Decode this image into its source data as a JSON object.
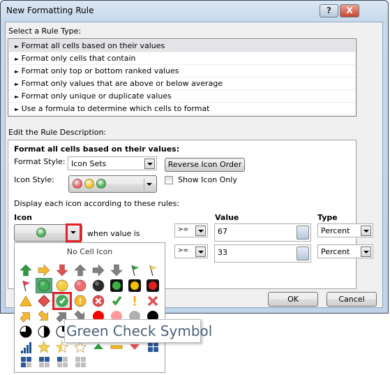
{
  "window": {
    "title": "New Formatting Rule",
    "help_label": "?",
    "close_label": "X"
  },
  "rule_type": {
    "label": "Select a Rule Type:",
    "items": [
      {
        "label": "Format all cells based on their values",
        "selected": true
      },
      {
        "label": "Format only cells that contain"
      },
      {
        "label": "Format only top or bottom ranked values"
      },
      {
        "label": "Format only values that are above or below average"
      },
      {
        "label": "Format only unique or duplicate values"
      },
      {
        "label": "Use a formula to determine which cells to format"
      }
    ],
    "bullet": "►"
  },
  "description": {
    "label": "Edit the Rule Description:",
    "heading": "Format all cells based on their values:",
    "format_style_label": "Format Style:",
    "format_style_value": "Icon Sets",
    "reverse_button": "Reverse Icon Order",
    "icon_style_label": "Icon Style:",
    "icon_style_colors": [
      "#e8636b",
      "#f5c52c",
      "#4caf5a"
    ],
    "show_icon_only_label": "Show Icon Only",
    "show_icon_only_checked": false,
    "rules_label": "Display each icon according to these rules:",
    "headers": {
      "icon": "Icon",
      "value": "Value",
      "type": "Type"
    },
    "rules": [
      {
        "icon_color": "#4caf5a",
        "when": "when value is",
        "operator": ">=",
        "value": "67",
        "type": "Percent"
      },
      {
        "operator": ">=",
        "value": "33",
        "type": "Percent"
      }
    ]
  },
  "buttons": {
    "ok": "OK",
    "cancel": "Cancel"
  },
  "icon_picker": {
    "no_icon_label": "No Cell Icon",
    "selected_icon": "green-circle",
    "hovered_icon": "green-check-symbol",
    "tooltip": "Green Check Symbol",
    "icons": [
      {
        "name": "green-up-arrow",
        "kind": "arrow",
        "rot": 0,
        "color": "#2e9b3e"
      },
      {
        "name": "yellow-right-arrow",
        "kind": "arrow",
        "rot": 90,
        "color": "#f5b82e"
      },
      {
        "name": "red-down-arrow",
        "kind": "arrow",
        "rot": 180,
        "color": "#e45050"
      },
      {
        "name": "gray-up-arrow",
        "kind": "arrow",
        "rot": 0,
        "color": "#808080"
      },
      {
        "name": "gray-right-arrow",
        "kind": "arrow",
        "rot": 90,
        "color": "#808080"
      },
      {
        "name": "gray-down-arrow",
        "kind": "arrow",
        "rot": 180,
        "color": "#808080"
      },
      {
        "name": "green-flag",
        "kind": "flag",
        "color": "#3a9b3a"
      },
      {
        "name": "yellow-flag",
        "kind": "flag",
        "color": "#f0d060"
      },
      {
        "name": "red-flag",
        "kind": "flag",
        "color": "#e04050"
      },
      {
        "name": "green-circle",
        "kind": "circle",
        "color": "#3fae55"
      },
      {
        "name": "yellow-circle",
        "kind": "circle",
        "color": "#f7cc40"
      },
      {
        "name": "red-circle",
        "kind": "circle",
        "color": "#ee6d70"
      },
      {
        "name": "black-circle",
        "kind": "circle",
        "color": "#2a2a2a"
      },
      {
        "name": "green-traffic-light",
        "kind": "light",
        "color": "#3cb043"
      },
      {
        "name": "yellow-traffic-light",
        "kind": "light",
        "color": "#f3c300"
      },
      {
        "name": "red-traffic-light",
        "kind": "light",
        "color": "#e02020"
      },
      {
        "name": "yellow-triangle",
        "kind": "triangle",
        "color": "#f5b82e"
      },
      {
        "name": "red-diamond",
        "kind": "diamond",
        "color": "#e45050"
      },
      {
        "name": "green-check-symbol",
        "kind": "symbol",
        "mark": "check",
        "color": "#3fae55"
      },
      {
        "name": "yellow-exclamation-symbol",
        "kind": "symbol",
        "mark": "excl",
        "color": "#f5b82e"
      },
      {
        "name": "red-cross-symbol",
        "kind": "symbol",
        "mark": "cross",
        "color": "#e45050"
      },
      {
        "name": "green-check",
        "kind": "mark",
        "mark": "check",
        "color": "#3a9b3a"
      },
      {
        "name": "yellow-exclamation",
        "kind": "mark",
        "mark": "excl",
        "color": "#f5a800"
      },
      {
        "name": "red-cross",
        "kind": "mark",
        "mark": "cross",
        "color": "#e05050"
      },
      {
        "name": "yellow-up-incline-arrow",
        "kind": "arrow",
        "rot": 45,
        "color": "#f5b82e"
      },
      {
        "name": "yellow-down-incline-arrow",
        "kind": "arrow",
        "rot": 135,
        "color": "#f5b82e"
      },
      {
        "name": "gray-up-incline-arrow",
        "kind": "arrow",
        "rot": 45,
        "color": "#808080"
      },
      {
        "name": "gray-down-incline-arrow",
        "kind": "arrow",
        "rot": 135,
        "color": "#808080"
      },
      {
        "name": "red-ball",
        "kind": "flat",
        "color": "#ff0000"
      },
      {
        "name": "pink-ball",
        "kind": "flat",
        "color": "#ff9a9a"
      },
      {
        "name": "gray-ball",
        "kind": "flat",
        "color": "#b0b0b0"
      },
      {
        "name": "black-ball",
        "kind": "flat",
        "color": "#000000"
      },
      {
        "name": "three-quarters-pie",
        "kind": "pie",
        "level": 3
      },
      {
        "name": "half-pie",
        "kind": "pie",
        "level": 2
      },
      {
        "name": "quarter-pie",
        "kind": "pie",
        "level": 1
      },
      {
        "name": "empty-pie",
        "kind": "pie",
        "level": 0
      },
      {
        "name": "full-pie",
        "kind": "pie",
        "level": 4
      },
      {
        "name": "signal-3-bars",
        "kind": "bars",
        "level": 3
      },
      {
        "name": "signal-2-bars",
        "kind": "bars",
        "level": 2
      },
      {
        "name": "signal-1-bar",
        "kind": "bars",
        "level": 1
      },
      {
        "name": "signal-4-bars",
        "kind": "bars",
        "level": 4
      },
      {
        "name": "gold-star",
        "kind": "star",
        "level": 2
      },
      {
        "name": "half-star",
        "kind": "star",
        "level": 1
      },
      {
        "name": "empty-star",
        "kind": "star",
        "level": 0
      },
      {
        "name": "green-up-triangle",
        "kind": "tri",
        "dir": "up",
        "color": "#2e9b3e"
      },
      {
        "name": "yellow-dash",
        "kind": "dash",
        "color": "#f5b82e"
      },
      {
        "name": "red-down-triangle",
        "kind": "tri",
        "dir": "down",
        "color": "#e45050"
      },
      {
        "name": "four-filled-boxes",
        "kind": "boxes",
        "level": 4
      },
      {
        "name": "three-filled-boxes",
        "kind": "boxes",
        "level": 3
      },
      {
        "name": "two-filled-boxes",
        "kind": "boxes",
        "level": 2
      },
      {
        "name": "one-filled-box",
        "kind": "boxes",
        "level": 1
      },
      {
        "name": "zero-filled-boxes",
        "kind": "boxes",
        "level": 0
      }
    ]
  }
}
